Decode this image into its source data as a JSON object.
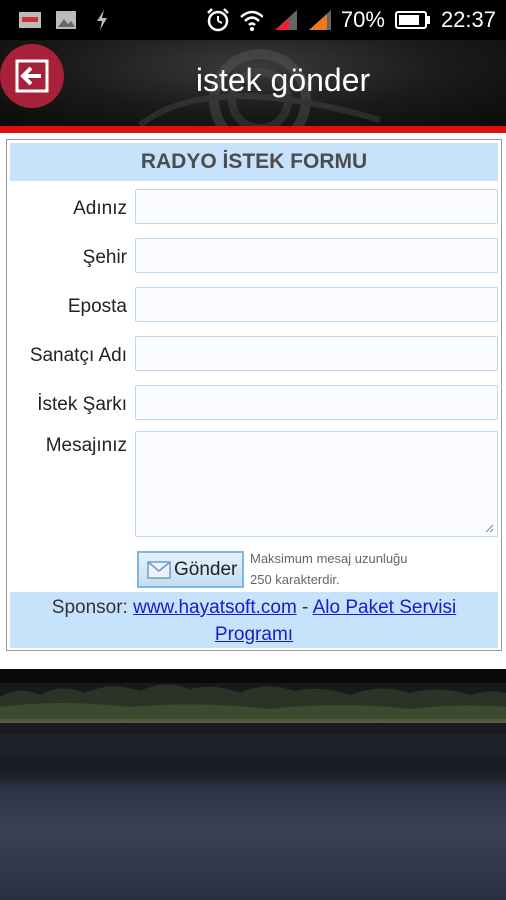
{
  "status_bar": {
    "battery_percent": "70%",
    "time": "22:37",
    "icons": [
      "app-notification-icon",
      "image-icon",
      "flash-icon",
      "alarm-icon",
      "wifi-icon",
      "signal-icon",
      "signal-icon",
      "battery-icon"
    ]
  },
  "header": {
    "title": "istek gönder",
    "back_icon": "back-arrow-icon"
  },
  "form": {
    "title": "RADYO İSTEK FORMU",
    "fields": [
      {
        "label": "Adınız",
        "value": ""
      },
      {
        "label": "Şehir",
        "value": ""
      },
      {
        "label": "Eposta",
        "value": ""
      },
      {
        "label": "Sanatçı Adı",
        "value": ""
      },
      {
        "label": "İstek Şarkı",
        "value": ""
      }
    ],
    "message_label": "Mesajınız",
    "message_value": "",
    "send_label": "Gönder",
    "note_line1": "Maksimum mesaj uzunluğu",
    "note_line2": "250 karakterdir.",
    "sponsor_prefix": "Sponsor:",
    "sponsor_link1": "www.hayatsoft.com",
    "sponsor_dash": "-",
    "sponsor_link2_line1": "Alo Paket Servisi",
    "sponsor_link2_line2": "Programı"
  },
  "colors": {
    "accent_red": "#e01010",
    "back_button": "#a8213a",
    "form_header_bg": "#c6e3fb",
    "link": "#1a1ad0"
  }
}
